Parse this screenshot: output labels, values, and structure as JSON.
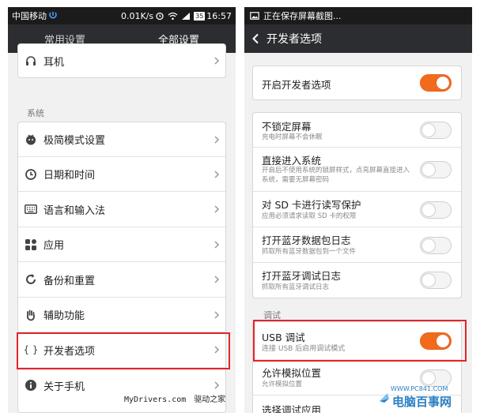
{
  "left": {
    "status": {
      "carrier": "中国移动",
      "speed": "0.01K/s",
      "battery": "35",
      "time": "16:57"
    },
    "tabs": [
      "常用设置",
      "全部设置"
    ],
    "top_item": "耳机",
    "section_label": "系统",
    "items": [
      {
        "label": "极简模式设置",
        "icon": "face-icon"
      },
      {
        "label": "日期和时间",
        "icon": "clock-icon"
      },
      {
        "label": "语言和输入法",
        "icon": "keyboard-icon"
      },
      {
        "label": "应用",
        "icon": "apps-icon"
      },
      {
        "label": "备份和重置",
        "icon": "refresh-icon"
      },
      {
        "label": "辅助功能",
        "icon": "hand-icon"
      },
      {
        "label": "开发者选项",
        "icon": "braces-icon",
        "glyph": "{ }"
      },
      {
        "label": "关于手机",
        "icon": "info-icon"
      }
    ]
  },
  "right": {
    "status": {
      "saving": "正在保存屏幕截图..."
    },
    "title": "开发者选项",
    "enable_dev": {
      "label": "开启开发者选项",
      "on": true
    },
    "options": [
      {
        "title": "不锁定屏幕",
        "desc": "充电时屏幕不会休眠",
        "on": false
      },
      {
        "title": "直接进入系统",
        "desc": "开启后不使用系统的锁屏样式，点亮屏幕直接进入系统，需要无屏幕密码",
        "on": false
      },
      {
        "title": "对 SD 卡进行读写保护",
        "desc": "应用必须请求读取 SD 卡的权限",
        "on": false
      },
      {
        "title": "打开蓝牙数据包日志",
        "desc": "抓取所有蓝牙数据包到一个文件",
        "on": false
      },
      {
        "title": "打开蓝牙调试日志",
        "desc": "抓取所有蓝牙调试日志",
        "on": false
      }
    ],
    "section_label": "调试",
    "debug": [
      {
        "title": "USB 调试",
        "desc": "连接 USB 后启用调试模式",
        "on": true
      },
      {
        "title": "允许模拟位置",
        "desc": "允许模拟位置",
        "on": false
      },
      {
        "title": "选择调试应用"
      }
    ]
  },
  "watermarks": {
    "mydrivers": "MyDrivers.com",
    "mydrivers_cn": "驱动之家",
    "pc841_url": "WWW.PC841.COM",
    "pc841_name": "电脑百事网"
  },
  "colors": {
    "toggle_on": "#f26b1d",
    "highlight": "#e4242a",
    "topbar": "#2b2d30",
    "watermark": "#2a7fc4"
  }
}
